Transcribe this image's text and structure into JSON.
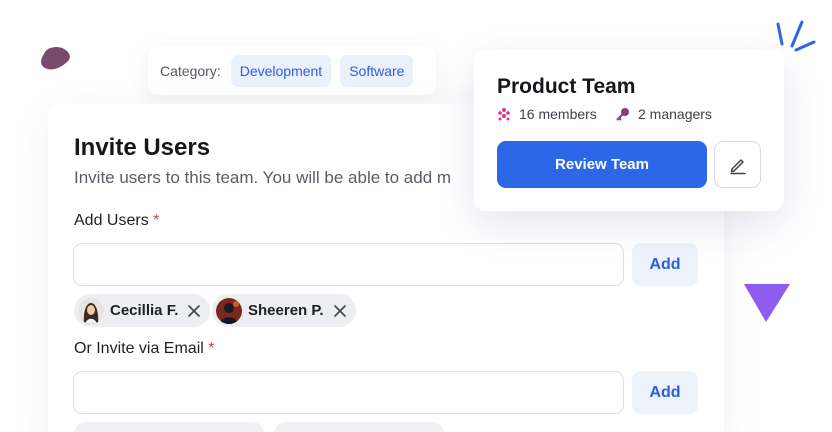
{
  "category": {
    "label": "Category:",
    "chips": [
      "Development",
      "Software"
    ]
  },
  "invite": {
    "title": "Invite Users",
    "subtitle": "Invite users to this team. You will be able to add m",
    "add_users_label": "Add Users",
    "required_mark": "*",
    "add_button": "Add",
    "email_label": "Or Invite via Email",
    "selected_users": [
      {
        "name": "Cecillia F."
      },
      {
        "name": "Sheeren P."
      }
    ]
  },
  "team": {
    "title": "Product Team",
    "members": "16 members",
    "managers": "2 managers",
    "review_button": "Review Team"
  },
  "colors": {
    "accent": "#2b67e6",
    "chip_bg": "#eaf0fc",
    "blob": "#7a4a6c",
    "triangle": "#8f5cf0",
    "members_icon": "#e0338c",
    "managers_icon": "#8b3a78"
  },
  "icons": {
    "members": "people-icon",
    "managers": "key-icon",
    "edit": "pencil-icon",
    "remove": "close-icon"
  }
}
